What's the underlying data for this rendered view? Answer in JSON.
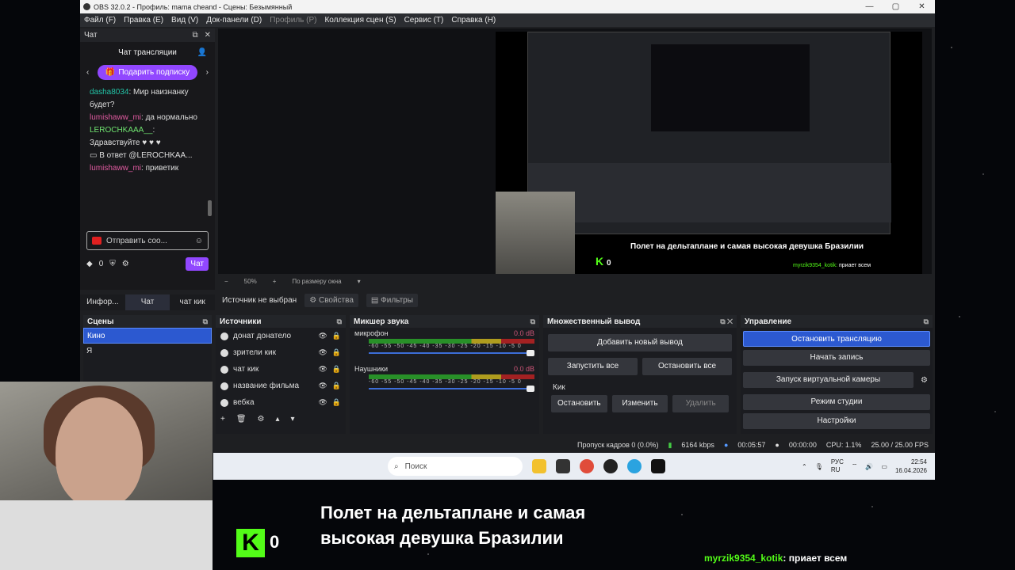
{
  "window": {
    "title": "OBS 32.0.2 - Профиль: mama cheand - Сцены: Безымянный",
    "min": "—",
    "max": "▢",
    "close": "✕"
  },
  "menu": [
    "Файл (F)",
    "Правка (E)",
    "Вид (V)",
    "Док-панели (D)",
    "Профиль (P)",
    "Коллекция сцен (S)",
    "Сервис (T)",
    "Справка (H)"
  ],
  "chat": {
    "dock_title": "Чат",
    "header": "Чат трансляции",
    "gift": "Подарить подписку",
    "messages": [
      {
        "user": "dasha8034",
        "text": ": Мир наизнанку будет?"
      },
      {
        "user": "lumishaww_mi",
        "text": ": да нормально"
      },
      {
        "user": "LEROCHKAAA__",
        "text": ": Здравствуйте ♥ ♥ ♥"
      },
      {
        "user": "",
        "text": "В ответ @LEROCHKAA..."
      },
      {
        "user": "lumishaww_mi",
        "text": ": приветик"
      }
    ],
    "input_placeholder": "Отправить соо...",
    "points": "0",
    "chat_btn": "Чат"
  },
  "dock_tabs": [
    "Инфор...",
    "Чат",
    "чат кик"
  ],
  "preview": {
    "zoom": "50%",
    "fit": "По размеру окна",
    "caption": "Полет на дельтаплане и самая высокая девушка Бразилии",
    "kick_count": "0",
    "tw_user": "myrzik9354_kotik",
    "tw_text": "приает всем"
  },
  "srcbar": {
    "none": "Источник не выбран",
    "props": "Свойства",
    "filters": "Фильтры"
  },
  "scenes": {
    "title": "Сцены",
    "items": [
      "Кино",
      "Я"
    ]
  },
  "sources": {
    "title": "Источники",
    "items": [
      "донат донатело",
      "зрители кик",
      "чат кик",
      "название фильма",
      "вебка"
    ]
  },
  "mixer": {
    "title": "Микшер звука",
    "channels": [
      {
        "name": "микрофон",
        "db": "0.0 dB"
      },
      {
        "name": "Наушники",
        "db": "0.0 dB"
      }
    ],
    "scale": "-60 -55 -50 -45 -40 -35 -30 -25 -20 -15 -10 -5 0"
  },
  "multi": {
    "title": "Множественный вывод",
    "add": "Добавить новый вывод",
    "start_all": "Запустить все",
    "stop_all": "Остановить все",
    "target": "Кик",
    "stop": "Остановить",
    "edit": "Изменить",
    "delete": "Удалить"
  },
  "control": {
    "title": "Управление",
    "buttons": [
      "Остановить трансляцию",
      "Начать запись",
      "Запуск виртуальной камеры",
      "Режим студии",
      "Настройки"
    ]
  },
  "status": {
    "dropped": "Пропуск кадров 0 (0.0%)",
    "kbps": "6164 kbps",
    "stream_time": "00:05:57",
    "rec_time": "00:00:00",
    "cpu": "CPU: 1.1%",
    "fps": "25.00 / 25.00 FPS"
  },
  "taskbar": {
    "search": "Поиск",
    "lang1": "РУС",
    "lang2": "RU",
    "time": "22:54",
    "date": "16.04.2026"
  },
  "colors": {
    "accent": "#2c59d0",
    "twitch": "#9147ff",
    "kick": "#53fc18"
  }
}
